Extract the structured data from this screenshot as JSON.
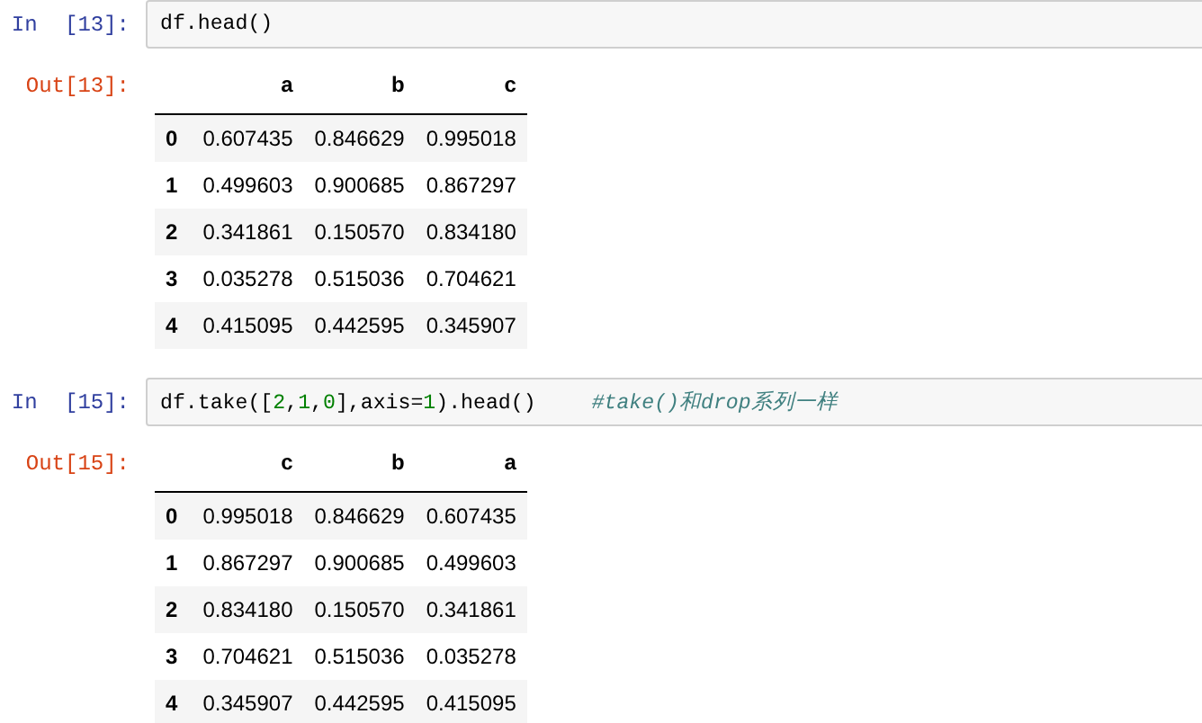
{
  "cells": [
    {
      "in_prompt": "In [13]:",
      "code": [
        {
          "kind": "plain",
          "text": "df.head()"
        }
      ],
      "out_prompt": "Out[13]:",
      "table": {
        "columns": [
          "a",
          "b",
          "c"
        ],
        "rows": [
          {
            "index": "0",
            "values": [
              "0.607435",
              "0.846629",
              "0.995018"
            ]
          },
          {
            "index": "1",
            "values": [
              "0.499603",
              "0.900685",
              "0.867297"
            ]
          },
          {
            "index": "2",
            "values": [
              "0.341861",
              "0.150570",
              "0.834180"
            ]
          },
          {
            "index": "3",
            "values": [
              "0.035278",
              "0.515036",
              "0.704621"
            ]
          },
          {
            "index": "4",
            "values": [
              "0.415095",
              "0.442595",
              "0.345907"
            ]
          }
        ]
      }
    },
    {
      "in_prompt": "In [15]:",
      "code": [
        {
          "kind": "plain",
          "text": "df.take(["
        },
        {
          "kind": "number",
          "text": "2"
        },
        {
          "kind": "plain",
          "text": ","
        },
        {
          "kind": "number",
          "text": "1"
        },
        {
          "kind": "plain",
          "text": ","
        },
        {
          "kind": "number",
          "text": "0"
        },
        {
          "kind": "plain",
          "text": "],axis="
        },
        {
          "kind": "number",
          "text": "1"
        },
        {
          "kind": "plain",
          "text": ").head()"
        },
        {
          "kind": "comment",
          "text": "#take()和drop系列一样"
        }
      ],
      "out_prompt": "Out[15]:",
      "table": {
        "columns": [
          "c",
          "b",
          "a"
        ],
        "rows": [
          {
            "index": "0",
            "values": [
              "0.995018",
              "0.846629",
              "0.607435"
            ]
          },
          {
            "index": "1",
            "values": [
              "0.867297",
              "0.900685",
              "0.499603"
            ]
          },
          {
            "index": "2",
            "values": [
              "0.834180",
              "0.150570",
              "0.341861"
            ]
          },
          {
            "index": "3",
            "values": [
              "0.704621",
              "0.515036",
              "0.035278"
            ]
          },
          {
            "index": "4",
            "values": [
              "0.345907",
              "0.442595",
              "0.415095"
            ]
          }
        ]
      }
    }
  ]
}
